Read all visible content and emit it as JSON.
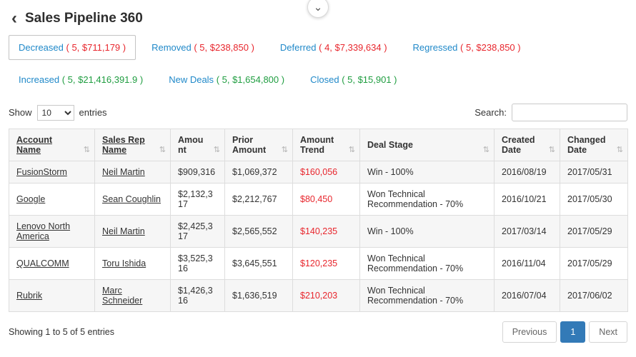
{
  "icons": {
    "back": "‹",
    "chevron_down": "⌄",
    "sort": "⇅"
  },
  "colors": {
    "link_blue": "#2089c9",
    "negative_red": "#e8262d",
    "positive_green": "#1f9d40",
    "active_page_bg": "#337ab7"
  },
  "header": {
    "title": "Sales Pipeline 360"
  },
  "tabs": [
    {
      "label": "Decreased",
      "stats": "( 5, $711,179 )",
      "color": "#e8262d"
    },
    {
      "label": "Removed",
      "stats": "( 5, $238,850 )",
      "color": "#e8262d"
    },
    {
      "label": "Deferred",
      "stats": "( 4, $7,339,634 )",
      "color": "#e8262d"
    },
    {
      "label": "Regressed",
      "stats": "( 5, $238,850 )",
      "color": "#e8262d"
    },
    {
      "label": "Increased",
      "stats": "( 5, $21,416,391.9 )",
      "color": "#1f9d40"
    },
    {
      "label": "New Deals",
      "stats": "( 5, $1,654,800 )",
      "color": "#1f9d40"
    },
    {
      "label": "Closed",
      "stats": "( 5, $15,901 )",
      "color": "#1f9d40"
    }
  ],
  "controls": {
    "show_label": "Show",
    "page_size": "10",
    "entries_label": "entries",
    "search_label": "Search:",
    "search_value": ""
  },
  "table": {
    "columns": [
      {
        "label": "Account Name"
      },
      {
        "label": "Sales Rep Name"
      },
      {
        "label": "Amount"
      },
      {
        "label": "Prior Amount"
      },
      {
        "label": "Amount Trend"
      },
      {
        "label": "Deal Stage"
      },
      {
        "label": "Created Date"
      },
      {
        "label": "Changed Date"
      }
    ],
    "rows": [
      {
        "account": "FusionStorm",
        "rep": "Neil Martin",
        "amount": "$909,316",
        "prior": "$1,069,372",
        "trend": "$160,056",
        "stage": "Win - 100%",
        "created": "2016/08/19",
        "changed": "2017/05/31"
      },
      {
        "account": "Google",
        "rep": "Sean Coughlin",
        "amount": "$2,132,317",
        "prior": "$2,212,767",
        "trend": "$80,450",
        "stage": "Won Technical Recommendation - 70%",
        "created": "2016/10/21",
        "changed": "2017/05/30"
      },
      {
        "account": "Lenovo North America",
        "rep": "Neil Martin",
        "amount": "$2,425,317",
        "prior": "$2,565,552",
        "trend": "$140,235",
        "stage": "Win - 100%",
        "created": "2017/03/14",
        "changed": "2017/05/29"
      },
      {
        "account": "QUALCOMM",
        "rep": "Toru Ishida",
        "amount": "$3,525,316",
        "prior": "$3,645,551",
        "trend": "$120,235",
        "stage": "Won Technical Recommendation - 70%",
        "created": "2016/11/04",
        "changed": "2017/05/29"
      },
      {
        "account": "Rubrik",
        "rep": "Marc Schneider",
        "amount": "$1,426,316",
        "prior": "$1,636,519",
        "trend": "$210,203",
        "stage": "Won Technical Recommendation - 70%",
        "created": "2016/07/04",
        "changed": "2017/06/02"
      }
    ]
  },
  "footer": {
    "info": "Showing 1 to 5 of 5 entries",
    "previous_label": "Previous",
    "page": "1",
    "next_label": "Next"
  }
}
